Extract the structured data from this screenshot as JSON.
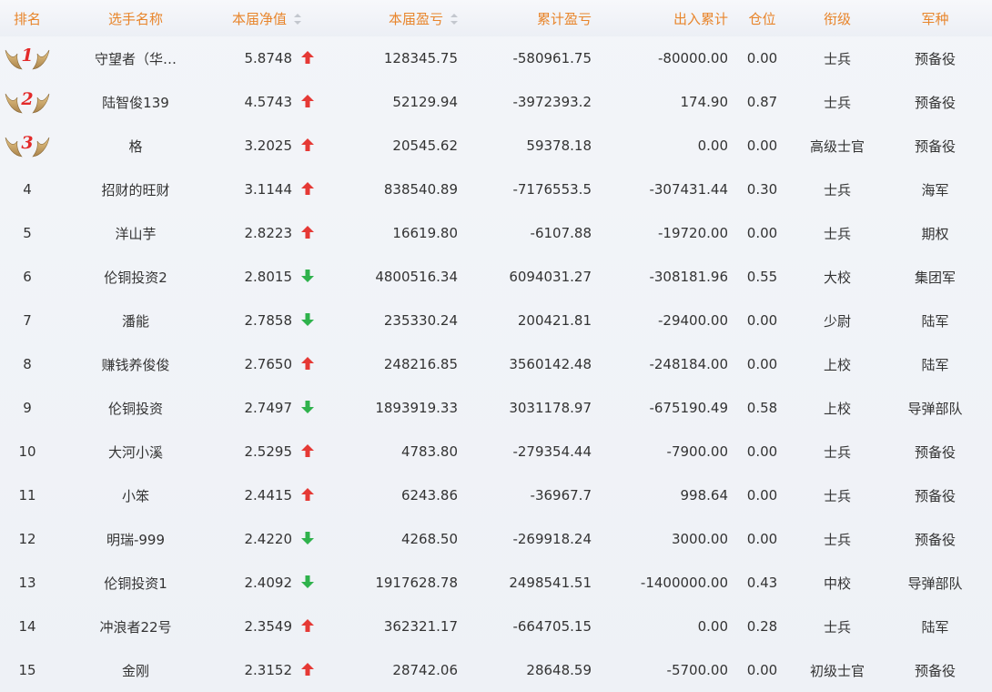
{
  "header": {
    "rank": "排名",
    "player": "选手名称",
    "nav": "本届净值",
    "profit": "本届盈亏",
    "cum_profit": "累计盈亏",
    "flow": "出入累计",
    "position": "仓位",
    "title": "衔级",
    "branch": "军种"
  },
  "colors": {
    "header_text": "#e8852b",
    "up_arrow": "#e53935",
    "down_arrow": "#2fb24c",
    "badge_number": "#e32a2a"
  },
  "rows": [
    {
      "rank": "1",
      "name": "守望者（华…",
      "nav": "5.8748",
      "trend": "up",
      "profit": "128345.75",
      "cum_profit": "-580961.75",
      "flow": "-80000.00",
      "position": "0.00",
      "title": "士兵",
      "branch": "预备役",
      "medal": true
    },
    {
      "rank": "2",
      "name": "陆智俊139",
      "nav": "4.5743",
      "trend": "up",
      "profit": "52129.94",
      "cum_profit": "-3972393.2",
      "flow": "174.90",
      "position": "0.87",
      "title": "士兵",
      "branch": "预备役",
      "medal": true
    },
    {
      "rank": "3",
      "name": "格",
      "nav": "3.2025",
      "trend": "up",
      "profit": "20545.62",
      "cum_profit": "59378.18",
      "flow": "0.00",
      "position": "0.00",
      "title": "高级士官",
      "branch": "预备役",
      "medal": true
    },
    {
      "rank": "4",
      "name": "招财的旺财",
      "nav": "3.1144",
      "trend": "up",
      "profit": "838540.89",
      "cum_profit": "-7176553.5",
      "flow": "-307431.44",
      "position": "0.30",
      "title": "士兵",
      "branch": "海军",
      "medal": false
    },
    {
      "rank": "5",
      "name": "洋山芋",
      "nav": "2.8223",
      "trend": "up",
      "profit": "16619.80",
      "cum_profit": "-6107.88",
      "flow": "-19720.00",
      "position": "0.00",
      "title": "士兵",
      "branch": "期权",
      "medal": false
    },
    {
      "rank": "6",
      "name": "伦铜投资2",
      "nav": "2.8015",
      "trend": "down",
      "profit": "4800516.34",
      "cum_profit": "6094031.27",
      "flow": "-308181.96",
      "position": "0.55",
      "title": "大校",
      "branch": "集团军",
      "medal": false
    },
    {
      "rank": "7",
      "name": "潘能",
      "nav": "2.7858",
      "trend": "down",
      "profit": "235330.24",
      "cum_profit": "200421.81",
      "flow": "-29400.00",
      "position": "0.00",
      "title": "少尉",
      "branch": "陆军",
      "medal": false
    },
    {
      "rank": "8",
      "name": "赚钱养俊俊",
      "nav": "2.7650",
      "trend": "up",
      "profit": "248216.85",
      "cum_profit": "3560142.48",
      "flow": "-248184.00",
      "position": "0.00",
      "title": "上校",
      "branch": "陆军",
      "medal": false
    },
    {
      "rank": "9",
      "name": "伦铜投资",
      "nav": "2.7497",
      "trend": "down",
      "profit": "1893919.33",
      "cum_profit": "3031178.97",
      "flow": "-675190.49",
      "position": "0.58",
      "title": "上校",
      "branch": "导弹部队",
      "medal": false
    },
    {
      "rank": "10",
      "name": "大河小溪",
      "nav": "2.5295",
      "trend": "up",
      "profit": "4783.80",
      "cum_profit": "-279354.44",
      "flow": "-7900.00",
      "position": "0.00",
      "title": "士兵",
      "branch": "预备役",
      "medal": false
    },
    {
      "rank": "11",
      "name": "小笨",
      "nav": "2.4415",
      "trend": "up",
      "profit": "6243.86",
      "cum_profit": "-36967.7",
      "flow": "998.64",
      "position": "0.00",
      "title": "士兵",
      "branch": "预备役",
      "medal": false
    },
    {
      "rank": "12",
      "name": "明瑞-999",
      "nav": "2.4220",
      "trend": "down",
      "profit": "4268.50",
      "cum_profit": "-269918.24",
      "flow": "3000.00",
      "position": "0.00",
      "title": "士兵",
      "branch": "预备役",
      "medal": false
    },
    {
      "rank": "13",
      "name": "伦铜投资1",
      "nav": "2.4092",
      "trend": "down",
      "profit": "1917628.78",
      "cum_profit": "2498541.51",
      "flow": "-1400000.00",
      "position": "0.43",
      "title": "中校",
      "branch": "导弹部队",
      "medal": false
    },
    {
      "rank": "14",
      "name": "冲浪者22号",
      "nav": "2.3549",
      "trend": "up",
      "profit": "362321.17",
      "cum_profit": "-664705.15",
      "flow": "0.00",
      "position": "0.28",
      "title": "士兵",
      "branch": "陆军",
      "medal": false
    },
    {
      "rank": "15",
      "name": "金刚",
      "nav": "2.3152",
      "trend": "up",
      "profit": "28742.06",
      "cum_profit": "28648.59",
      "flow": "-5700.00",
      "position": "0.00",
      "title": "初级士官",
      "branch": "预备役",
      "medal": false
    }
  ]
}
